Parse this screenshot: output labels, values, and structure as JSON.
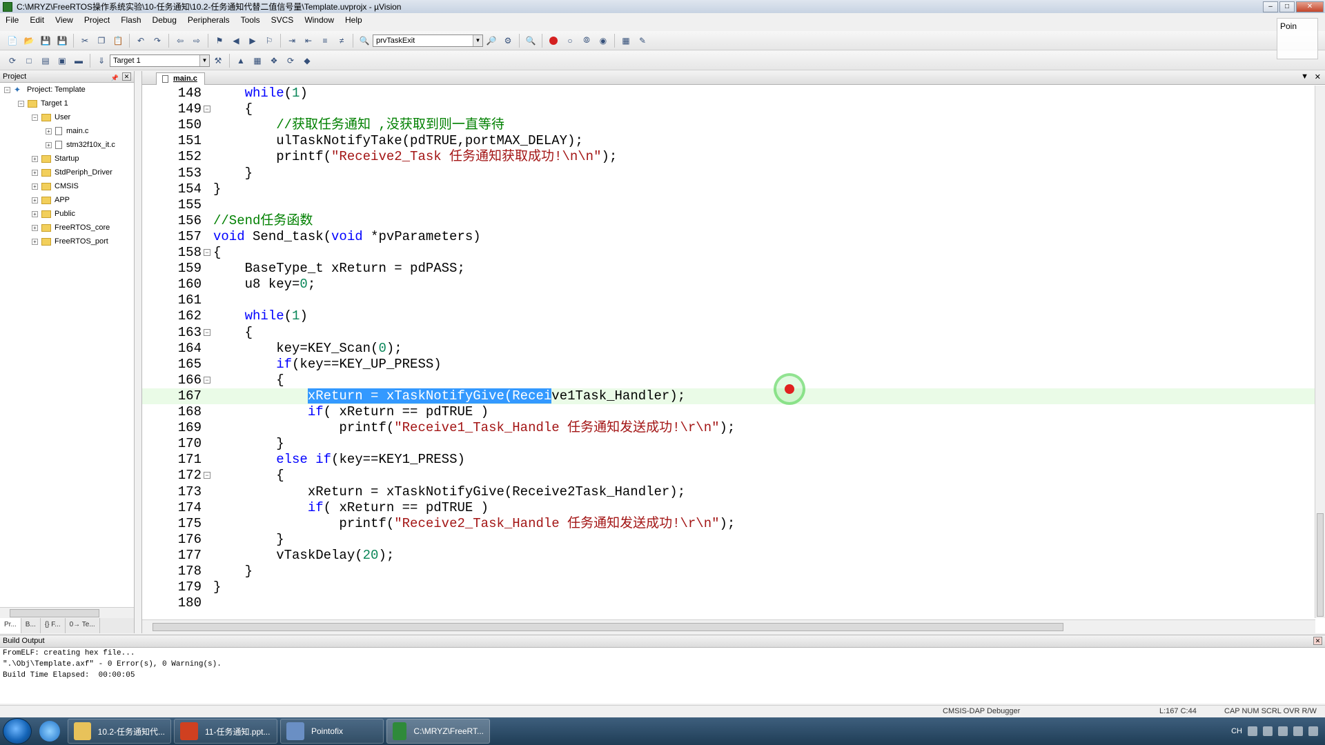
{
  "window": {
    "title": "C:\\MRYZ\\FreeRTOS操作系统实验\\10-任务通知\\10.2-任务通知代替二值信号量\\Template.uvprojx - µVision"
  },
  "menu": [
    "File",
    "Edit",
    "View",
    "Project",
    "Flash",
    "Debug",
    "Peripherals",
    "Tools",
    "SVCS",
    "Window",
    "Help"
  ],
  "toolbar": {
    "find_combo_value": "prvTaskExit",
    "target_combo_value": "Target 1"
  },
  "ghost_panel": {
    "label": "Poin"
  },
  "project": {
    "header": "Project",
    "tree": [
      {
        "label": "Project: Template",
        "level": 0,
        "kind": "project",
        "expander": "-"
      },
      {
        "label": "Target 1",
        "level": 1,
        "kind": "folder",
        "expander": "-"
      },
      {
        "label": "User",
        "level": 2,
        "kind": "folder",
        "expander": "-"
      },
      {
        "label": "main.c",
        "level": 3,
        "kind": "file",
        "expander": "+"
      },
      {
        "label": "stm32f10x_it.c",
        "level": 3,
        "kind": "file",
        "expander": "+"
      },
      {
        "label": "Startup",
        "level": 2,
        "kind": "folder",
        "expander": "+"
      },
      {
        "label": "StdPeriph_Driver",
        "level": 2,
        "kind": "folder",
        "expander": "+"
      },
      {
        "label": "CMSIS",
        "level": 2,
        "kind": "folder",
        "expander": "+"
      },
      {
        "label": "APP",
        "level": 2,
        "kind": "folder",
        "expander": "+"
      },
      {
        "label": "Public",
        "level": 2,
        "kind": "folder",
        "expander": "+"
      },
      {
        "label": "FreeRTOS_core",
        "level": 2,
        "kind": "folder",
        "expander": "+"
      },
      {
        "label": "FreeRTOS_port",
        "level": 2,
        "kind": "folder",
        "expander": "+"
      }
    ],
    "bottom_tabs": [
      "Pr...",
      "B...",
      "{} F...",
      "0→ Te..."
    ]
  },
  "editor": {
    "tab": "main.c",
    "current_line": 167,
    "lines": [
      {
        "n": "148",
        "fold": "",
        "tokens": [
          [
            "",
            "    "
          ],
          [
            "kw",
            "while"
          ],
          [
            "",
            "("
          ],
          [
            "num",
            "1"
          ],
          [
            "",
            ")"
          ]
        ]
      },
      {
        "n": "149",
        "fold": "-",
        "tokens": [
          [
            "",
            "    {"
          ]
        ]
      },
      {
        "n": "150",
        "fold": "",
        "tokens": [
          [
            "",
            "        "
          ],
          [
            "cm",
            "//获取任务通知 ,没获取到则一直等待"
          ]
        ]
      },
      {
        "n": "151",
        "fold": "",
        "tokens": [
          [
            "",
            "        ulTaskNotifyTake(pdTRUE,portMAX_DELAY);"
          ]
        ]
      },
      {
        "n": "152",
        "fold": "",
        "tokens": [
          [
            "",
            "        printf("
          ],
          [
            "str",
            "\"Receive2_Task 任务通知获取成功!\\n\\n\""
          ],
          [
            "",
            ");"
          ]
        ]
      },
      {
        "n": "153",
        "fold": "",
        "tokens": [
          [
            "",
            "    }"
          ]
        ]
      },
      {
        "n": "154",
        "fold": "",
        "tokens": [
          [
            "",
            "}"
          ]
        ]
      },
      {
        "n": "155",
        "fold": "",
        "tokens": []
      },
      {
        "n": "156",
        "fold": "",
        "tokens": [
          [
            "cm",
            "//Send任务函数"
          ]
        ]
      },
      {
        "n": "157",
        "fold": "",
        "tokens": [
          [
            "kw",
            "void"
          ],
          [
            "",
            " Send_task("
          ],
          [
            "kw",
            "void"
          ],
          [
            "",
            " *pvParameters)"
          ]
        ]
      },
      {
        "n": "158",
        "fold": "-",
        "tokens": [
          [
            "",
            "{"
          ]
        ]
      },
      {
        "n": "159",
        "fold": "",
        "tokens": [
          [
            "",
            "    BaseType_t xReturn = pdPASS;"
          ]
        ]
      },
      {
        "n": "160",
        "fold": "",
        "tokens": [
          [
            "",
            "    u8 key="
          ],
          [
            "num",
            "0"
          ],
          [
            "",
            ";"
          ]
        ]
      },
      {
        "n": "161",
        "fold": "",
        "tokens": []
      },
      {
        "n": "162",
        "fold": "",
        "tokens": [
          [
            "",
            "    "
          ],
          [
            "kw",
            "while"
          ],
          [
            "",
            "("
          ],
          [
            "num",
            "1"
          ],
          [
            "",
            ")"
          ]
        ]
      },
      {
        "n": "163",
        "fold": "-",
        "tokens": [
          [
            "",
            "    {"
          ]
        ]
      },
      {
        "n": "164",
        "fold": "",
        "tokens": [
          [
            "",
            "        key=KEY_Scan("
          ],
          [
            "num",
            "0"
          ],
          [
            "",
            ");"
          ]
        ]
      },
      {
        "n": "165",
        "fold": "",
        "tokens": [
          [
            "",
            "        "
          ],
          [
            "kw",
            "if"
          ],
          [
            "",
            "(key==KEY_UP_PRESS)"
          ]
        ]
      },
      {
        "n": "166",
        "fold": "-",
        "tokens": [
          [
            "",
            "        {"
          ]
        ]
      },
      {
        "n": "167",
        "fold": "",
        "tokens": [
          [
            "",
            "            "
          ],
          [
            "sel",
            "xReturn = xTaskNotifyGive(Recei"
          ],
          [
            "",
            "ve1Task_Handler);"
          ]
        ]
      },
      {
        "n": "168",
        "fold": "",
        "tokens": [
          [
            "",
            "            "
          ],
          [
            "kw",
            "if"
          ],
          [
            "",
            "( xReturn == pdTRUE )"
          ]
        ]
      },
      {
        "n": "169",
        "fold": "",
        "tokens": [
          [
            "",
            "                printf("
          ],
          [
            "str",
            "\"Receive1_Task_Handle 任务通知发送成功!\\r\\n\""
          ],
          [
            "",
            ");"
          ]
        ]
      },
      {
        "n": "170",
        "fold": "",
        "tokens": [
          [
            "",
            "        }"
          ]
        ]
      },
      {
        "n": "171",
        "fold": "",
        "tokens": [
          [
            "",
            "        "
          ],
          [
            "kw",
            "else if"
          ],
          [
            "",
            "(key==KEY1_PRESS)"
          ]
        ]
      },
      {
        "n": "172",
        "fold": "-",
        "tokens": [
          [
            "",
            "        {"
          ]
        ]
      },
      {
        "n": "173",
        "fold": "",
        "tokens": [
          [
            "",
            "            xReturn = xTaskNotifyGive(Receive2Task_Handler);"
          ]
        ]
      },
      {
        "n": "174",
        "fold": "",
        "tokens": [
          [
            "",
            "            "
          ],
          [
            "kw",
            "if"
          ],
          [
            "",
            "( xReturn == pdTRUE )"
          ]
        ]
      },
      {
        "n": "175",
        "fold": "",
        "tokens": [
          [
            "",
            "                printf("
          ],
          [
            "str",
            "\"Receive2_Task_Handle 任务通知发送成功!\\r\\n\""
          ],
          [
            "",
            ");"
          ]
        ]
      },
      {
        "n": "176",
        "fold": "",
        "tokens": [
          [
            "",
            "        }"
          ]
        ]
      },
      {
        "n": "177",
        "fold": "",
        "tokens": [
          [
            "",
            "        vTaskDelay("
          ],
          [
            "num",
            "20"
          ],
          [
            "",
            ");"
          ]
        ]
      },
      {
        "n": "178",
        "fold": "",
        "tokens": [
          [
            "",
            "    }"
          ]
        ]
      },
      {
        "n": "179",
        "fold": "",
        "tokens": [
          [
            "",
            "}"
          ]
        ]
      },
      {
        "n": "180",
        "fold": "",
        "tokens": []
      }
    ]
  },
  "build_output": {
    "header": "Build Output",
    "lines": [
      "FromELF: creating hex file...",
      "\".\\Obj\\Template.axf\" - 0 Error(s), 0 Warning(s).",
      "Build Time Elapsed:  00:00:05"
    ]
  },
  "status": {
    "debugger": "CMSIS-DAP Debugger",
    "position": "L:167 C:44",
    "indicators": "CAP  NUM  SCRL  OVR  R/W"
  },
  "taskbar": {
    "items": [
      {
        "label": "10.2-任务通知代...",
        "color": "#e8c25a"
      },
      {
        "label": "11-任务通知.ppt...",
        "color": "#d04020"
      },
      {
        "label": "Pointofix",
        "color": "#6a8fc4"
      },
      {
        "label": "C:\\MRYZ\\FreeRT...",
        "color": "#2f8a3a"
      }
    ],
    "tray_lang": "CH"
  }
}
